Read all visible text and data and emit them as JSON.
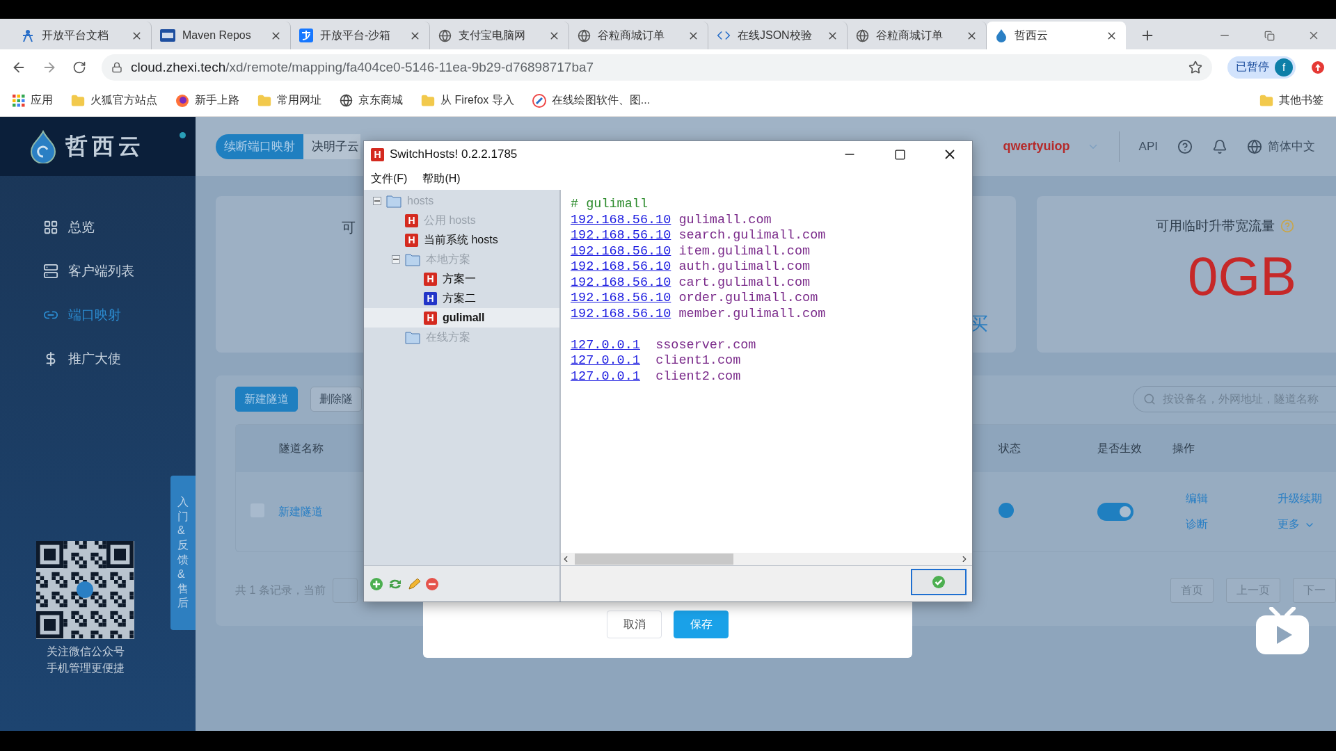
{
  "browser": {
    "tabs": [
      {
        "title": "开放平台文档",
        "selected": false
      },
      {
        "title": "Maven Repos",
        "selected": false
      },
      {
        "title": "开放平台-沙箱",
        "selected": false
      },
      {
        "title": "支付宝电脑网",
        "selected": false
      },
      {
        "title": "谷粒商城订单",
        "selected": false
      },
      {
        "title": "在线JSON校验",
        "selected": false
      },
      {
        "title": "谷粒商城订单",
        "selected": false
      },
      {
        "title": "哲西云",
        "selected": true
      }
    ],
    "url_host": "cloud.zhexi.tech",
    "url_path": "/xd/remote/mapping/fa404ce0-5146-11ea-9b29-d76898717ba7",
    "profile": {
      "label": "已暂停",
      "avatar": "f"
    },
    "bookmarks": [
      "应用",
      "火狐官方站点",
      "新手上路",
      "常用网址",
      "京东商城",
      "从 Firefox 导入",
      "在线绘图软件、图..."
    ],
    "other_bookmarks": "其他书签"
  },
  "sidebar": {
    "brand": "哲西云",
    "items": [
      {
        "label": "总览",
        "selected": false
      },
      {
        "label": "客户端列表",
        "selected": false
      },
      {
        "label": "端口映射",
        "selected": true
      },
      {
        "label": "推广大使",
        "selected": false
      }
    ],
    "qr_caption": [
      "关注微信公众号",
      "手机管理更便捷"
    ],
    "feedback_tab": "入门&反馈&售后"
  },
  "header": {
    "tabs": [
      {
        "label": "续断端口映射",
        "selected": true
      },
      {
        "label": "决明子云",
        "selected": false
      }
    ],
    "user": "qwertyuiop",
    "api": "API",
    "language": "简体中文"
  },
  "balance_card": {
    "label": "可",
    "link": "买"
  },
  "traffic_card": {
    "title": "可用临时升带宽流量",
    "value": "0GB"
  },
  "tunnels": {
    "buttons": [
      {
        "label": "新建隧道",
        "kind": "primary"
      },
      {
        "label": "删除隧",
        "kind": "default"
      }
    ],
    "search_placeholder": "按设备名，外网地址，隧道名称",
    "columns": [
      "隧道名称",
      "状态",
      "是否生效",
      "操作"
    ],
    "rows": [
      {
        "checked": false,
        "name": "新建隧道",
        "online": true,
        "enabled": true,
        "actions": [
          "编辑",
          "诊断",
          "升级续期",
          "更多"
        ]
      }
    ],
    "summary": "共 1 条记录，当前",
    "pager": [
      "首页",
      "上一页",
      "下一"
    ]
  },
  "dialog": {
    "buttons": [
      {
        "label": "取消",
        "kind": "default"
      },
      {
        "label": "保存",
        "kind": "primary"
      }
    ]
  },
  "switchhosts": {
    "icon_letter": "H",
    "title": "SwitchHosts! 0.2.2.1785",
    "menu": [
      "文件(F)",
      "帮助(H)"
    ],
    "tree": [
      {
        "label": "hosts",
        "kind": "folder",
        "expanded": true,
        "disabled": true,
        "selected": false,
        "children": [
          {
            "label": "公用 hosts",
            "kind": "hosts",
            "icon_letter": "H",
            "color": "#d42a1f",
            "disabled": true,
            "selected": false
          },
          {
            "label": "当前系统 hosts",
            "kind": "hosts",
            "icon_letter": "H",
            "color": "#d42a1f",
            "disabled": false,
            "selected": false
          },
          {
            "label": "本地方案",
            "kind": "folder",
            "expanded": true,
            "disabled": true,
            "selected": false,
            "children": [
              {
                "label": "方案一",
                "kind": "hosts",
                "icon_letter": "H",
                "color": "#d42a1f",
                "disabled": false,
                "selected": false
              },
              {
                "label": "方案二",
                "kind": "hosts",
                "icon_letter": "H",
                "color": "#2235c8",
                "disabled": false,
                "selected": false
              },
              {
                "label": "gulimall",
                "kind": "hosts",
                "icon_letter": "H",
                "color": "#d42a1f",
                "disabled": false,
                "selected": true
              }
            ]
          },
          {
            "label": "在线方案",
            "kind": "folder",
            "disabled": true,
            "selected": false
          }
        ]
      }
    ],
    "lines": [
      {
        "kind": "comment",
        "text": "# gulimall"
      },
      {
        "kind": "entry",
        "ip": "192.168.56.10",
        "host": "gulimall.com"
      },
      {
        "kind": "entry",
        "ip": "192.168.56.10",
        "host": "search.gulimall.com"
      },
      {
        "kind": "entry",
        "ip": "192.168.56.10",
        "host": "item.gulimall.com"
      },
      {
        "kind": "entry",
        "ip": "192.168.56.10",
        "host": "auth.gulimall.com"
      },
      {
        "kind": "entry",
        "ip": "192.168.56.10",
        "host": "cart.gulimall.com"
      },
      {
        "kind": "entry",
        "ip": "192.168.56.10",
        "host": "order.gulimall.com"
      },
      {
        "kind": "entry",
        "ip": "192.168.56.10",
        "host": "member.gulimall.com"
      },
      {
        "kind": "blank"
      },
      {
        "kind": "entry",
        "ip": "127.0.0.1",
        "host": "ssoserver.com"
      },
      {
        "kind": "entry",
        "ip": "127.0.0.1",
        "host": "client1.com"
      },
      {
        "kind": "entry",
        "ip": "127.0.0.1",
        "host": "client2.com"
      }
    ]
  }
}
